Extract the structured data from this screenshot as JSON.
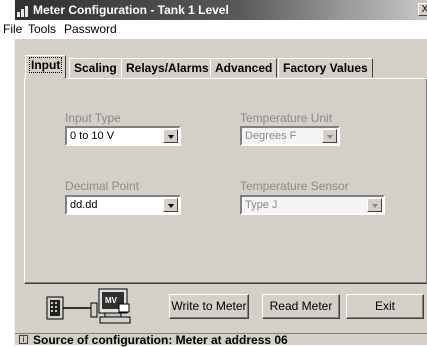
{
  "window": {
    "title": "Meter Configuration - Tank 1 Level",
    "close_label": "X"
  },
  "menu": {
    "items": [
      "File",
      "Tools",
      "Password"
    ]
  },
  "tabs": [
    {
      "label": "Input",
      "active": true
    },
    {
      "label": "Scaling",
      "active": false
    },
    {
      "label": "Relays/Alarms",
      "active": false
    },
    {
      "label": "Advanced",
      "active": false
    },
    {
      "label": "Factory Values",
      "active": false
    }
  ],
  "input_panel": {
    "input_type": {
      "label": "Input Type",
      "value": "0 to 10 V",
      "enabled": true
    },
    "temperature_unit": {
      "label": "Temperature Unit",
      "value": "Degrees F",
      "enabled": false
    },
    "decimal_point": {
      "label": "Decimal Point",
      "value": "dd.dd",
      "enabled": true
    },
    "temperature_sensor": {
      "label": "Temperature Sensor",
      "value": "Type J",
      "enabled": false
    }
  },
  "connection_graphic": {
    "device_icon": "meter-device-icon",
    "computer_icon": "computer-icon",
    "computer_badge": "MV"
  },
  "actions": {
    "write_label": "Write to Meter",
    "read_label": "Read Meter",
    "exit_label": "Exit"
  },
  "status_bar": {
    "text": "Source of configuration: Meter at address 06"
  },
  "colors": {
    "titlebar_start": "#303030",
    "face": "#d4d0c8",
    "disabled_text": "#8a8a8a"
  }
}
